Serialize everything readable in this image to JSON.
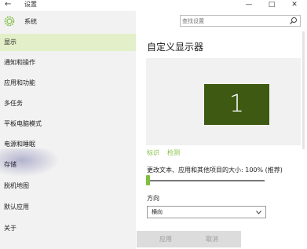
{
  "window": {
    "back": "←",
    "title": "设置",
    "minimize": "—",
    "maximize": "□",
    "close": "✕"
  },
  "sidebar": {
    "header": "系统",
    "items": [
      {
        "label": "显示",
        "selected": true
      },
      {
        "label": "通知和操作"
      },
      {
        "label": "应用和功能"
      },
      {
        "label": "多任务"
      },
      {
        "label": "平板电脑模式"
      },
      {
        "label": "电源和睡眠"
      },
      {
        "label": "存储"
      },
      {
        "label": "脱机地图"
      },
      {
        "label": "默认应用"
      },
      {
        "label": "关于"
      }
    ]
  },
  "search": {
    "placeholder": "查找设置"
  },
  "main": {
    "title": "自定义显示器",
    "monitor_number": "1",
    "identify_link": "标识",
    "detect_link": "检测",
    "scale_label": "更改文本、应用和其他项目的大小: 100% (推荐)",
    "scale_value_fraction": 0.0,
    "orientation_label": "方向",
    "orientation_value": "横向",
    "apply_button": "应用",
    "cancel_button": "取消"
  },
  "colors": {
    "accent": "#7fbf3d",
    "monitor": "#3e5a12",
    "selected_nav": "#e3efc8"
  }
}
